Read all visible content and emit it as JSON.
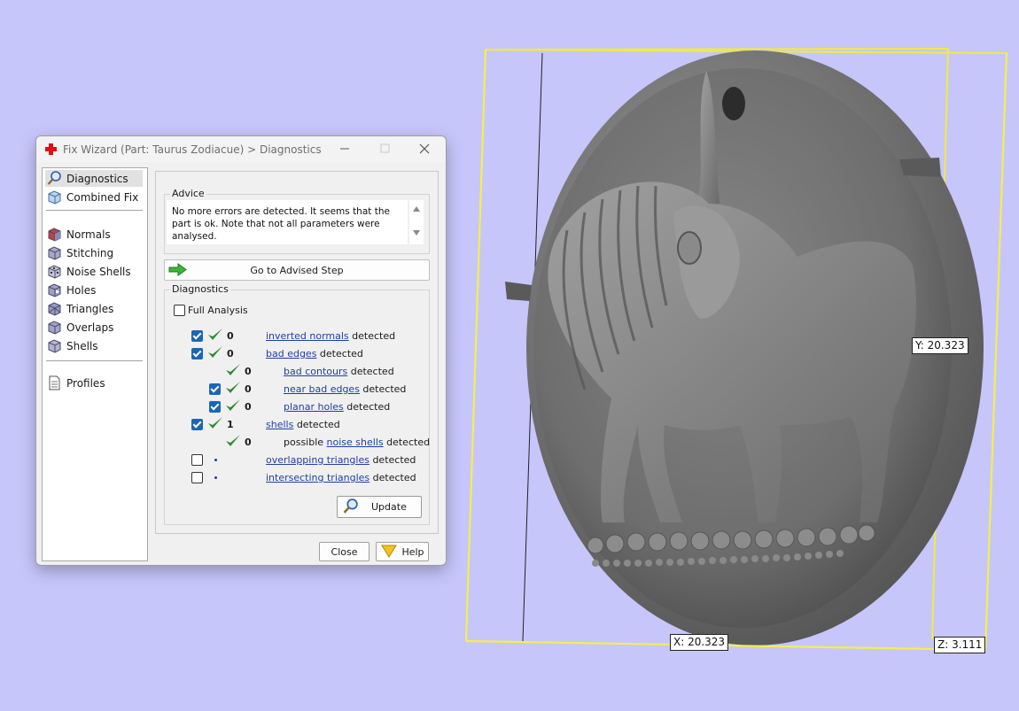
{
  "window": {
    "title": "Fix Wizard (Part: Taurus Zodiacue) > Diagnostics",
    "controls": [
      "minimize",
      "maximize",
      "close"
    ]
  },
  "nav": {
    "items": [
      {
        "label": "Diagnostics",
        "icon": "magnifier-icon",
        "selected": true
      },
      {
        "label": "Combined Fix",
        "icon": "cube-icon"
      },
      {
        "label": "Normals",
        "icon": "cube-icon"
      },
      {
        "label": "Stitching",
        "icon": "cube-icon"
      },
      {
        "label": "Noise Shells",
        "icon": "cube-icon"
      },
      {
        "label": "Holes",
        "icon": "cube-icon"
      },
      {
        "label": "Triangles",
        "icon": "cube-icon"
      },
      {
        "label": "Overlaps",
        "icon": "cube-icon"
      },
      {
        "label": "Shells",
        "icon": "cube-icon"
      },
      {
        "label": "Profiles",
        "icon": "document-icon"
      }
    ]
  },
  "advice": {
    "title": "Advice",
    "text": "No more errors are detected. It seems that the part is ok. Note that not all parameters were analysed."
  },
  "goto_button": {
    "label": "Go to Advised Step"
  },
  "diagnostics": {
    "title": "Diagnostics",
    "full_analysis": {
      "label": "Full Analysis",
      "checked": false
    },
    "rows": [
      {
        "checked": true,
        "status": "ok",
        "count": "0",
        "prefix": "",
        "link": "inverted normals",
        "suffix": " detected"
      },
      {
        "checked": true,
        "status": "ok",
        "count": "0",
        "prefix": "",
        "link": "bad edges",
        "suffix": " detected"
      },
      {
        "checkbox": false,
        "status": "ok",
        "count": "0",
        "prefix": "",
        "link": "bad contours",
        "suffix": " detected"
      },
      {
        "checked": true,
        "status": "ok",
        "count": "0",
        "prefix": "",
        "link": "near bad edges",
        "suffix": " detected"
      },
      {
        "checked": true,
        "status": "ok",
        "count": "0",
        "prefix": "",
        "link": "planar holes",
        "suffix": " detected"
      },
      {
        "checked": true,
        "status": "ok",
        "count": "1",
        "prefix": "",
        "link": "shells",
        "suffix": " detected"
      },
      {
        "checkbox": false,
        "status": "ok",
        "count": "0",
        "prefix": "possible ",
        "link": "noise shells",
        "suffix": " detected"
      },
      {
        "checked": false,
        "status": "pending",
        "count": "",
        "prefix": "",
        "link": "overlapping triangles",
        "suffix": " detected"
      },
      {
        "checked": false,
        "status": "pending",
        "count": "",
        "prefix": "",
        "link": "intersecting triangles",
        "suffix": " detected"
      }
    ],
    "update_label": "Update"
  },
  "buttons": {
    "close": "Close",
    "help": "Help"
  },
  "viewport": {
    "dimensions": {
      "x": "X: 20.323",
      "y": "Y: 20.323",
      "z": "Z: 3.111"
    },
    "colors": {
      "background": "#c6c6fb",
      "bounding_box": "#f5f04a",
      "model": "#6f6f6f"
    }
  }
}
